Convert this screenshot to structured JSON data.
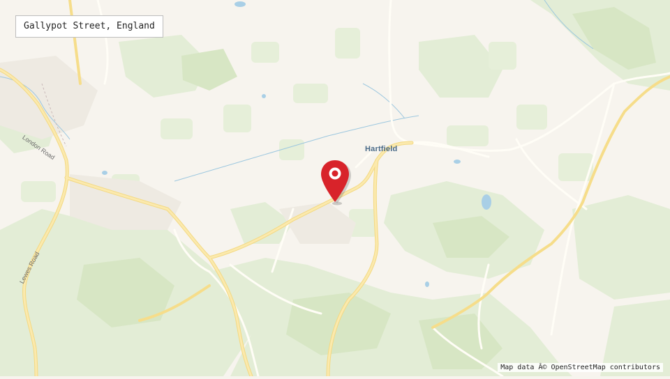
{
  "location": {
    "title": "Gallypot Street, England"
  },
  "map": {
    "place_labels": [
      {
        "id": "hartfield",
        "text": "Hartfield"
      }
    ],
    "road_labels": [
      {
        "id": "london-road",
        "text": "London Road"
      },
      {
        "id": "lewes-road",
        "text": "Lewes Road"
      }
    ],
    "marker_icon": "map-pin-icon",
    "colors": {
      "land": "#f7f4ee",
      "woodland": "#e2ecd4",
      "woodland_dark": "#d6e5c3",
      "main_road": "#f6dd8a",
      "minor_road": "#fffdf6",
      "water": "#a9cfe6",
      "marker": "#d8232a"
    }
  },
  "attribution": {
    "text": "Map data Â© OpenStreetMap contributors"
  }
}
